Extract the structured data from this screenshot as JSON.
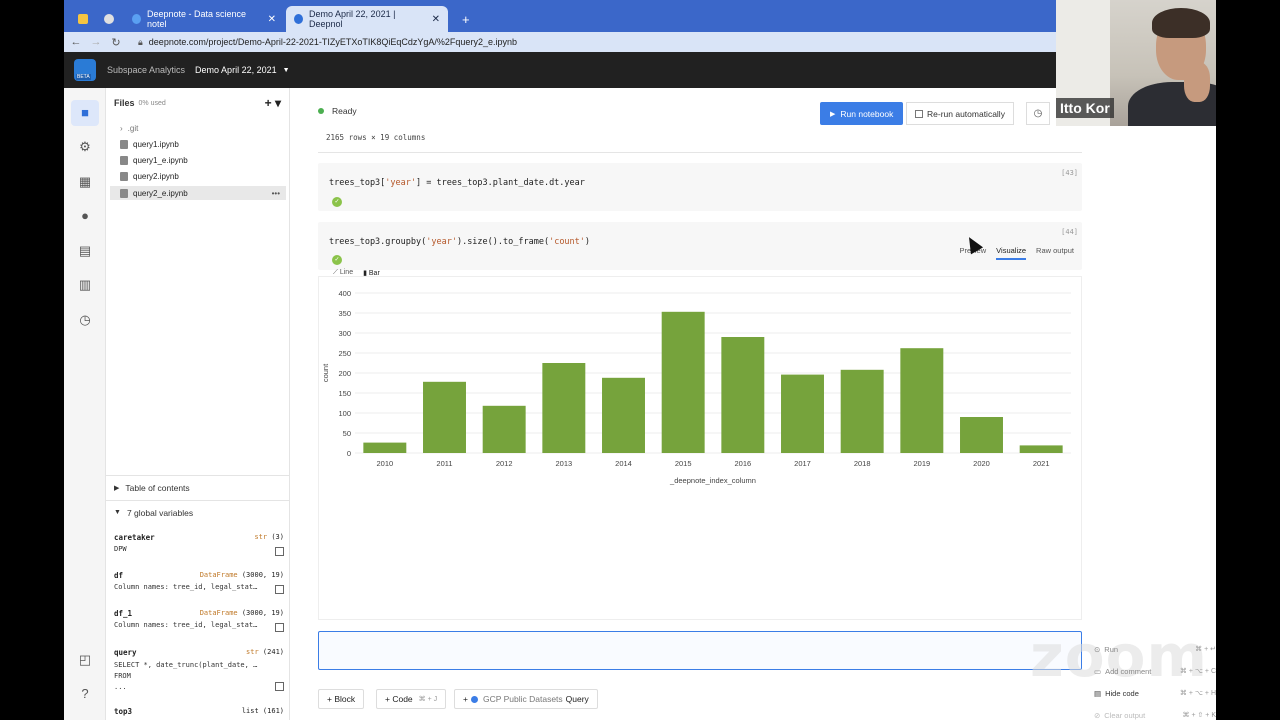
{
  "browser": {
    "tabs": [
      {
        "label": "Deepnote - Data science notel"
      },
      {
        "label": "Demo April 22, 2021 | Deepnol"
      }
    ],
    "url": "deepnote.com/project/Demo-April-22-2021-TIZyETXoTIK8QiEqCdzYgA/%2Fquery2_e.ipynb"
  },
  "app": {
    "logo_badge": "BETA",
    "workspace": "Subspace Analytics",
    "project": "Demo April 22, 2021"
  },
  "files": {
    "title": "Files",
    "usage": "0% used",
    "items": [
      {
        "label": ".git"
      },
      {
        "label": "query1.ipynb"
      },
      {
        "label": "query1_e.ipynb"
      },
      {
        "label": "query2.ipynb"
      },
      {
        "label": "query2_e.ipynb"
      }
    ],
    "toc_label": "Table of contents",
    "globals_label": "7 global variables",
    "globals": [
      {
        "name": "caretaker",
        "type": "str",
        "size": "(3)",
        "desc": "DPW"
      },
      {
        "name": "df",
        "type": "DataFrame",
        "size": "(3000, 19)",
        "desc": "Column names: tree_id, legal_stat…"
      },
      {
        "name": "df_1",
        "type": "DataFrame",
        "size": "(3000, 19)",
        "desc": "Column names: tree_id, legal_stat…"
      },
      {
        "name": "query",
        "type": "str",
        "size": "(241)",
        "desc": "SELECT *, date_trunc(plant_date, …\nFROM\n..."
      },
      {
        "name": "top3",
        "type": "list",
        "size": "(161)",
        "desc": ""
      }
    ]
  },
  "notebook": {
    "status": "Ready",
    "run_label": "Run notebook",
    "rerun_label": "Re-run automatically",
    "table_summary": "2165 rows × 19 columns",
    "cell43": {
      "num": "[43]",
      "code_pre": "trees_top3[",
      "code_str": "'year'",
      "code_post": "] = trees_top3.plant_date.dt.year"
    },
    "cell44": {
      "num": "[44]",
      "code_pre": "trees_top3.groupby(",
      "code_str1": "'year'",
      "code_mid": ").size().to_frame(",
      "code_str2": "'count'",
      "code_post": ")"
    },
    "output_tabs": [
      "Preview",
      "Visualize",
      "Raw output"
    ],
    "chart_tabs": [
      "Line",
      "Bar"
    ],
    "add_block": "+ Block",
    "add_code": "+ Code",
    "add_code_key": "⌘ + J",
    "add_query_pre": "+",
    "add_query_src": "GCP Public Datasets",
    "add_query_label": "Query"
  },
  "chart_data": {
    "type": "bar",
    "categories": [
      "2010",
      "2011",
      "2012",
      "2013",
      "2014",
      "2015",
      "2016",
      "2017",
      "2018",
      "2019",
      "2020",
      "2021"
    ],
    "values": [
      26,
      178,
      118,
      225,
      188,
      353,
      290,
      196,
      208,
      262,
      90,
      19
    ],
    "xlabel": "_deepnote_index_column",
    "ylabel": "count",
    "ylim": [
      0,
      400
    ],
    "yticks": [
      "0",
      "50",
      "100",
      "150",
      "200",
      "250",
      "300",
      "350",
      "400"
    ],
    "color": "#76a33c",
    "grid": true
  },
  "webcam": {
    "name": "Itto Kor"
  },
  "context_menu": [
    {
      "label": "Run",
      "keys": "⌘ + ↵"
    },
    {
      "label": "Add comment",
      "keys": "⌘ + ⌥ + C"
    },
    {
      "label": "Hide code",
      "keys": "⌘ + ⌥ + H"
    },
    {
      "label": "Clear output",
      "keys": "⌘ + ⇧ + K"
    }
  ],
  "zoom_watermark": "zoom"
}
